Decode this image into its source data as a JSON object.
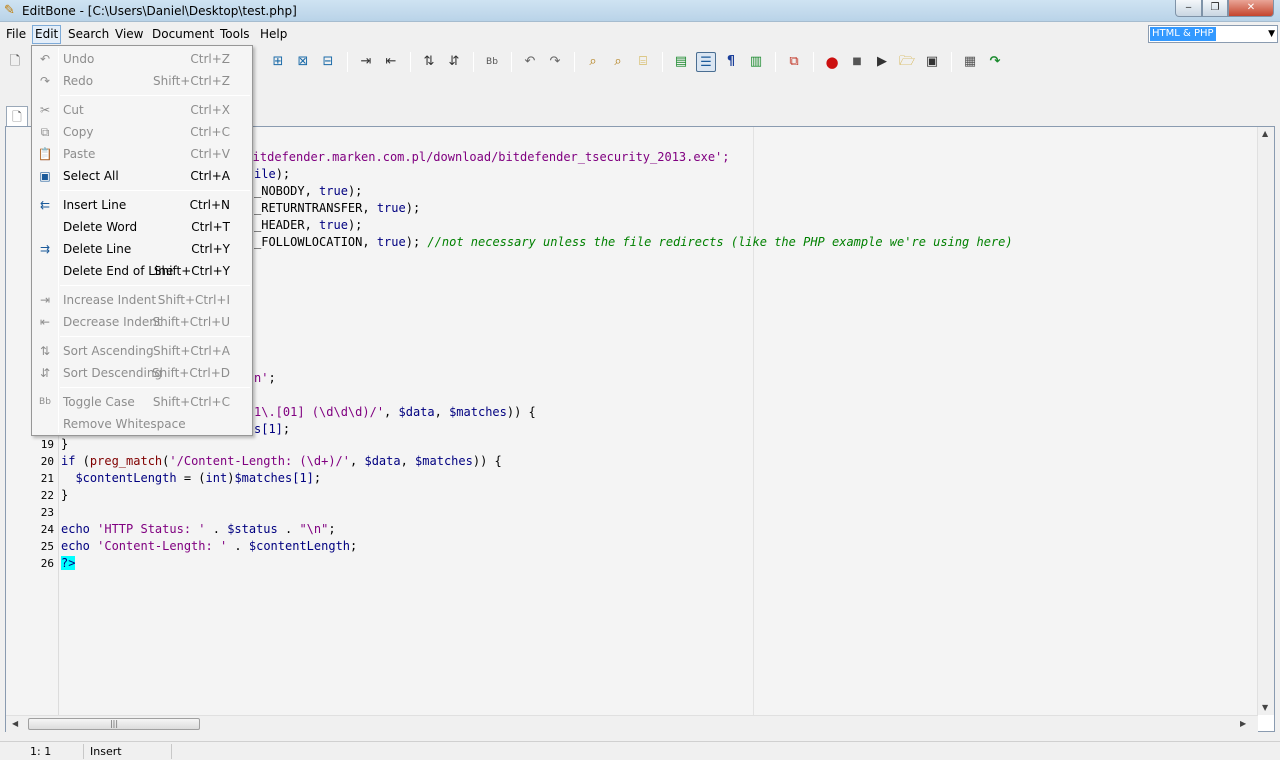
{
  "window": {
    "title": "EditBone - [C:\\Users\\Daniel\\Desktop\\test.php]",
    "minimize_glyph": "‒",
    "maximize_glyph": "❐",
    "close_glyph": "✕"
  },
  "menubar": {
    "items": [
      "File",
      "Edit",
      "Search",
      "View",
      "Document",
      "Tools",
      "Help"
    ],
    "language": "HTML & PHP"
  },
  "toolbar": {
    "icons": [
      "new-file-icon",
      "add-item-icon",
      "delete-item-icon",
      "edit-item-icon",
      "increase-indent-icon",
      "decrease-indent-icon",
      "sort-ascending-icon",
      "sort-descending-icon",
      "toggle-case-icon",
      "undo-icon",
      "redo-icon",
      "find-icon",
      "find-replace-icon",
      "find-in-files-icon",
      "toggle-panel-icon",
      "line-numbers-icon",
      "pilcrow-icon",
      "word-wrap-icon",
      "compare-icon",
      "record-icon",
      "stop-icon",
      "play-icon",
      "open-macro-icon",
      "save-macro-icon",
      "calendar-icon",
      "redirect-icon"
    ]
  },
  "editor": {
    "visible_line_numbers": [
      "19",
      "20",
      "21",
      "22",
      "23",
      "24",
      "25",
      "26"
    ],
    "fragments": {
      "l2": "w.bitdefender.marken.com.pl/download/bitdefender_tsecurity_2013.exe';",
      "l3_var": "ile",
      "l3_rest": ");",
      "l4_a": "_NOBODY, ",
      "l4_b": "true",
      "l4_c": ");",
      "l5_a": "_RETURNTRANSFER, ",
      "l5_b": "true",
      "l5_c": ");",
      "l6_a": "_HEADER, ",
      "l6_b": "true",
      "l6_c": ");",
      "l7_a": "_FOLLOWLOCATION, ",
      "l7_b": "true",
      "l7_c": "); ",
      "l7_comment": "//not necessary unless the file redirects (like the PHP example we're using here)",
      "l15_a": "n'",
      "l15_b": ";",
      "l17_a": "1\\.[01] (\\d\\d\\d)/'",
      "l17_b": ", ",
      "l17_c": "$data",
      "l17_d": ", ",
      "l17_e": "$matches",
      "l17_f": ")) {",
      "l18_a": "s",
      "l18_b": "[1]",
      "l18_c": ";"
    },
    "code": {
      "l19": "}",
      "l20_kw": "if",
      "l20_a": " (",
      "l20_fn": "preg_match",
      "l20_b": "(",
      "l20_str": "'/Content-Length: (\\d+)/'",
      "l20_c": ", ",
      "l20_v1": "$data",
      "l20_d": ", ",
      "l20_v2": "$matches",
      "l20_e": ")) {",
      "l21_v1": "$contentLength",
      "l21_a": " = (",
      "l21_kw": "int",
      "l21_b": ")",
      "l21_v2": "$matches",
      "l21_c": "[1]",
      "l21_d": ";",
      "l22": "}",
      "l24_kw": "echo",
      "l24_s1": " 'HTTP Status: '",
      "l24_a": " . ",
      "l24_v": "$status",
      "l24_b": " . ",
      "l24_s2": "\"\\n\"",
      "l24_c": ";",
      "l25_kw": "echo",
      "l25_s1": " 'Content-Length: '",
      "l25_a": " . ",
      "l25_v": "$contentLength",
      "l25_c": ";",
      "l26": "?>"
    },
    "hscroll_grip": "|||",
    "scroll_left_arrow": "◀",
    "scroll_right_arrow": "▶",
    "scroll_up_arrow": "▲",
    "scroll_down_arrow": "▼"
  },
  "statusbar": {
    "position": "1: 1",
    "mode": "Insert"
  },
  "edit_menu": {
    "items": [
      {
        "label": "Undo",
        "shortcut": "Ctrl+Z",
        "icon": "undo-icon",
        "enabled": false
      },
      {
        "label": "Redo",
        "shortcut": "Shift+Ctrl+Z",
        "icon": "redo-icon",
        "enabled": false
      },
      {
        "label": "Cut",
        "shortcut": "Ctrl+X",
        "icon": "scissors-icon",
        "enabled": false
      },
      {
        "label": "Copy",
        "shortcut": "Ctrl+C",
        "icon": "copy-icon",
        "enabled": false
      },
      {
        "label": "Paste",
        "shortcut": "Ctrl+V",
        "icon": "paste-icon",
        "enabled": false
      },
      {
        "label": "Select All",
        "shortcut": "Ctrl+A",
        "icon": "select-all-icon",
        "enabled": true
      },
      {
        "label": "Insert Line",
        "shortcut": "Ctrl+N",
        "icon": "insert-line-icon",
        "enabled": true
      },
      {
        "label": "Delete Word",
        "shortcut": "Ctrl+T",
        "icon": "",
        "enabled": true
      },
      {
        "label": "Delete Line",
        "shortcut": "Ctrl+Y",
        "icon": "delete-line-icon",
        "enabled": true
      },
      {
        "label": "Delete End of Line",
        "shortcut": "Shift+Ctrl+Y",
        "icon": "",
        "enabled": true
      },
      {
        "label": "Increase Indent",
        "shortcut": "Shift+Ctrl+I",
        "icon": "increase-indent-icon",
        "enabled": false
      },
      {
        "label": "Decrease Indent",
        "shortcut": "Shift+Ctrl+U",
        "icon": "decrease-indent-icon",
        "enabled": false
      },
      {
        "label": "Sort Ascending",
        "shortcut": "Shift+Ctrl+A",
        "icon": "sort-ascending-icon",
        "enabled": false
      },
      {
        "label": "Sort Descending",
        "shortcut": "Shift+Ctrl+D",
        "icon": "sort-descending-icon",
        "enabled": false
      },
      {
        "label": "Toggle Case",
        "shortcut": "Shift+Ctrl+C",
        "icon": "toggle-case-icon",
        "enabled": false
      },
      {
        "label": "Remove Whitespace",
        "shortcut": "",
        "icon": "",
        "enabled": false
      }
    ]
  }
}
